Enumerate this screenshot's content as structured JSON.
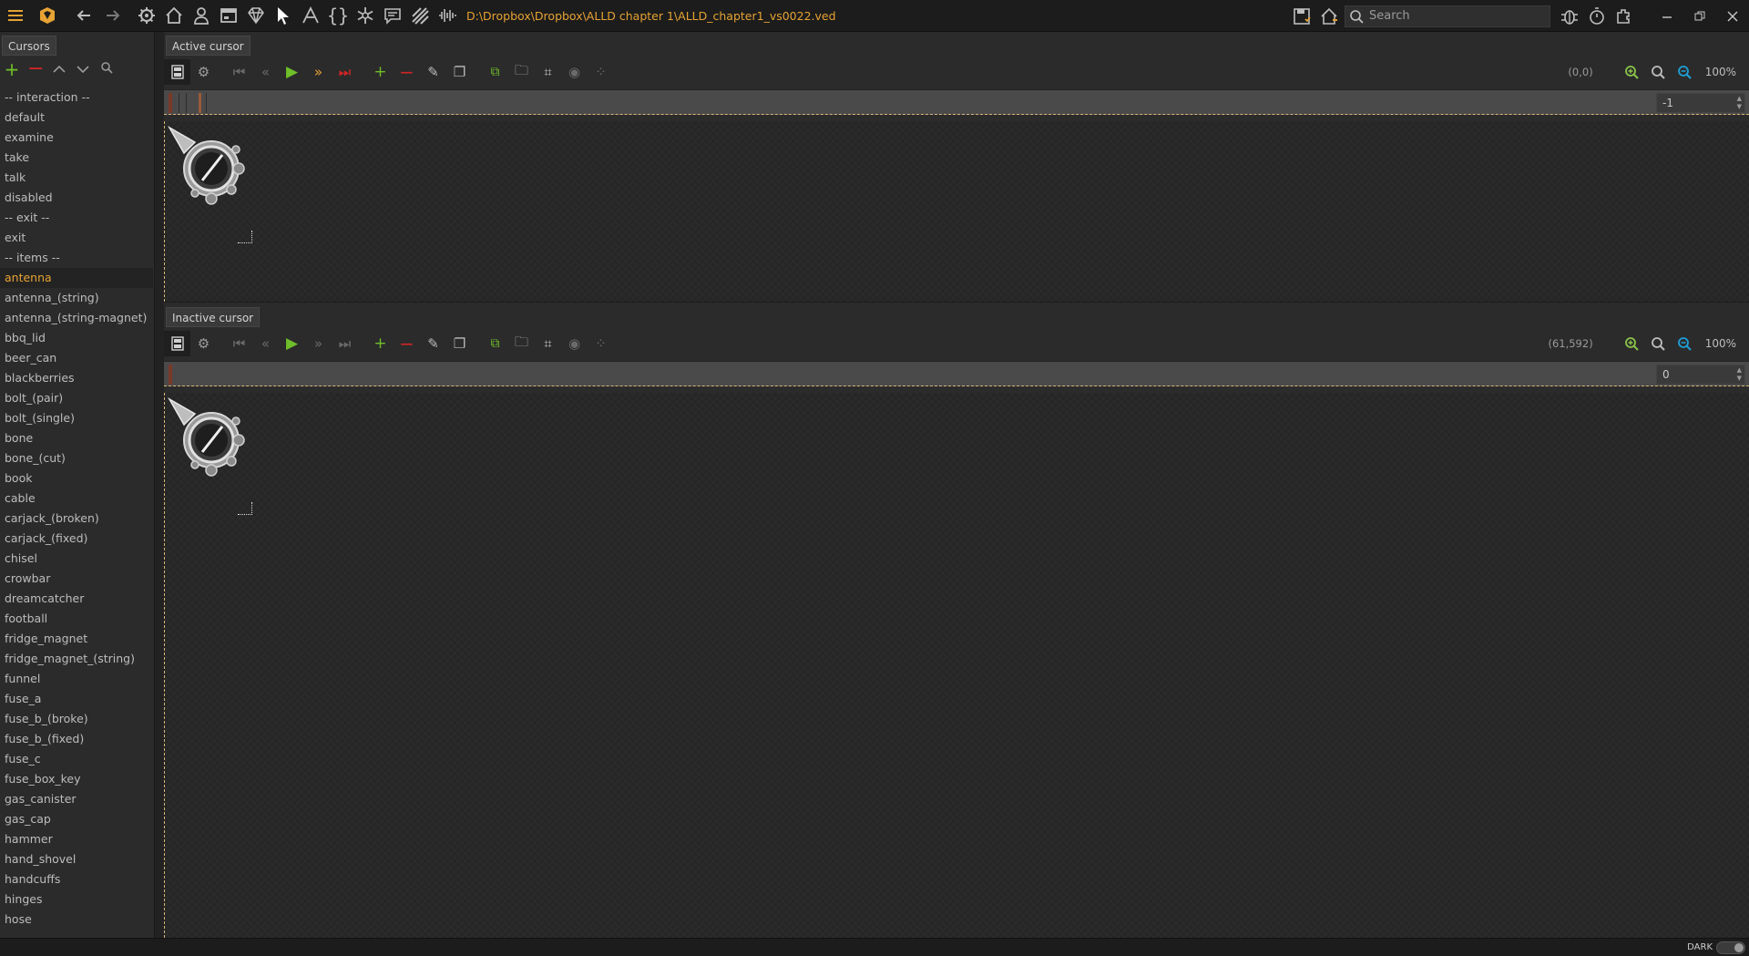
{
  "topbar": {
    "file_path": "D:\\Dropbox\\Dropbox\\ALLD chapter 1\\ALLD_chapter1_vs0022.ved",
    "search_placeholder": "Search",
    "icons": [
      "menu-icon",
      "app-logo-icon",
      "back-icon",
      "forward-icon",
      "settings-icon",
      "home-icon",
      "characters-icon",
      "interfaces-icon",
      "gem-icon",
      "cursor-icon",
      "text-icon",
      "scripts-icon",
      "particles-icon",
      "dialog-icon",
      "shaders-icon",
      "audio-icon"
    ]
  },
  "left_panel": {
    "tab_label": "Cursors",
    "items": [
      {
        "label": "-- interaction --"
      },
      {
        "label": "default"
      },
      {
        "label": "examine"
      },
      {
        "label": "take"
      },
      {
        "label": "talk"
      },
      {
        "label": "disabled"
      },
      {
        "label": "-- exit --"
      },
      {
        "label": "exit"
      },
      {
        "label": "-- items --"
      },
      {
        "label": "antenna",
        "selected": true
      },
      {
        "label": "antenna_(string)"
      },
      {
        "label": "antenna_(string-magnet)"
      },
      {
        "label": "bbq_lid"
      },
      {
        "label": "beer_can"
      },
      {
        "label": "blackberries"
      },
      {
        "label": "bolt_(pair)"
      },
      {
        "label": "bolt_(single)"
      },
      {
        "label": "bone"
      },
      {
        "label": "bone_(cut)"
      },
      {
        "label": "book"
      },
      {
        "label": "cable"
      },
      {
        "label": "carjack_(broken)"
      },
      {
        "label": "carjack_(fixed)"
      },
      {
        "label": "chisel"
      },
      {
        "label": "crowbar"
      },
      {
        "label": "dreamcatcher"
      },
      {
        "label": "football"
      },
      {
        "label": "fridge_magnet"
      },
      {
        "label": "fridge_magnet_(string)"
      },
      {
        "label": "funnel"
      },
      {
        "label": "fuse_a"
      },
      {
        "label": "fuse_b_(broke)"
      },
      {
        "label": "fuse_b_(fixed)"
      },
      {
        "label": "fuse_c"
      },
      {
        "label": "fuse_box_key"
      },
      {
        "label": "gas_canister"
      },
      {
        "label": "gas_cap"
      },
      {
        "label": "hammer"
      },
      {
        "label": "hand_shovel"
      },
      {
        "label": "handcuffs"
      },
      {
        "label": "hinges"
      },
      {
        "label": "hose"
      }
    ]
  },
  "active": {
    "tab_label": "Active cursor",
    "coords": "(0,0)",
    "zoom": "100%",
    "frame_value": "-1"
  },
  "inactive": {
    "tab_label": "Inactive cursor",
    "coords": "(61,592)",
    "zoom": "100%",
    "frame_value": "0"
  },
  "statusbar": {
    "theme_label": "DARK"
  },
  "colors": {
    "accent": "#e6a233",
    "add_green": "#6fbf2a",
    "remove_red": "#d02525",
    "zoom_in_green": "#8bc34a",
    "zoom_out_blue": "#1ea0d6"
  }
}
